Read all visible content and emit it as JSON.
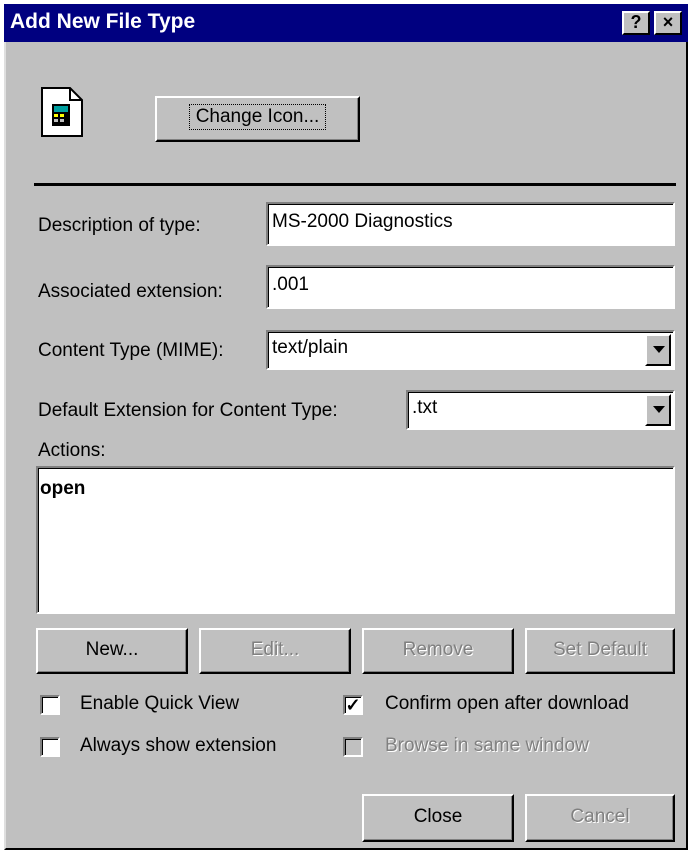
{
  "window": {
    "title": "Add New File Type",
    "help_glyph": "?",
    "close_glyph": "×"
  },
  "icon_area": {
    "icon": "file-type-icon",
    "change_icon_label": "Change Icon..."
  },
  "fields": {
    "description": {
      "label": "Description of type:",
      "value": "MS-2000 Diagnostics"
    },
    "extension": {
      "label": "Associated extension:",
      "value": ".001"
    },
    "content_type": {
      "label": "Content Type (MIME):",
      "value": "text/plain"
    },
    "default_ext": {
      "label": "Default Extension for Content Type:",
      "value": ".txt"
    }
  },
  "actions": {
    "label": "Actions:",
    "items": [
      "open"
    ]
  },
  "action_buttons": {
    "new": "New...",
    "edit": "Edit...",
    "remove": "Remove",
    "set_default": "Set Default"
  },
  "options": {
    "quick_view": {
      "label": "Enable Quick View",
      "checked": false
    },
    "confirm_open": {
      "label": "Confirm open after download",
      "checked": true
    },
    "always_show": {
      "label": "Always show extension",
      "checked": false
    },
    "browse_same": {
      "label": "Browse in same window",
      "checked": false,
      "disabled": true
    }
  },
  "footer": {
    "close": "Close",
    "cancel": "Cancel"
  },
  "colors": {
    "titlebar": "#000080",
    "face": "#c0c0c0"
  }
}
